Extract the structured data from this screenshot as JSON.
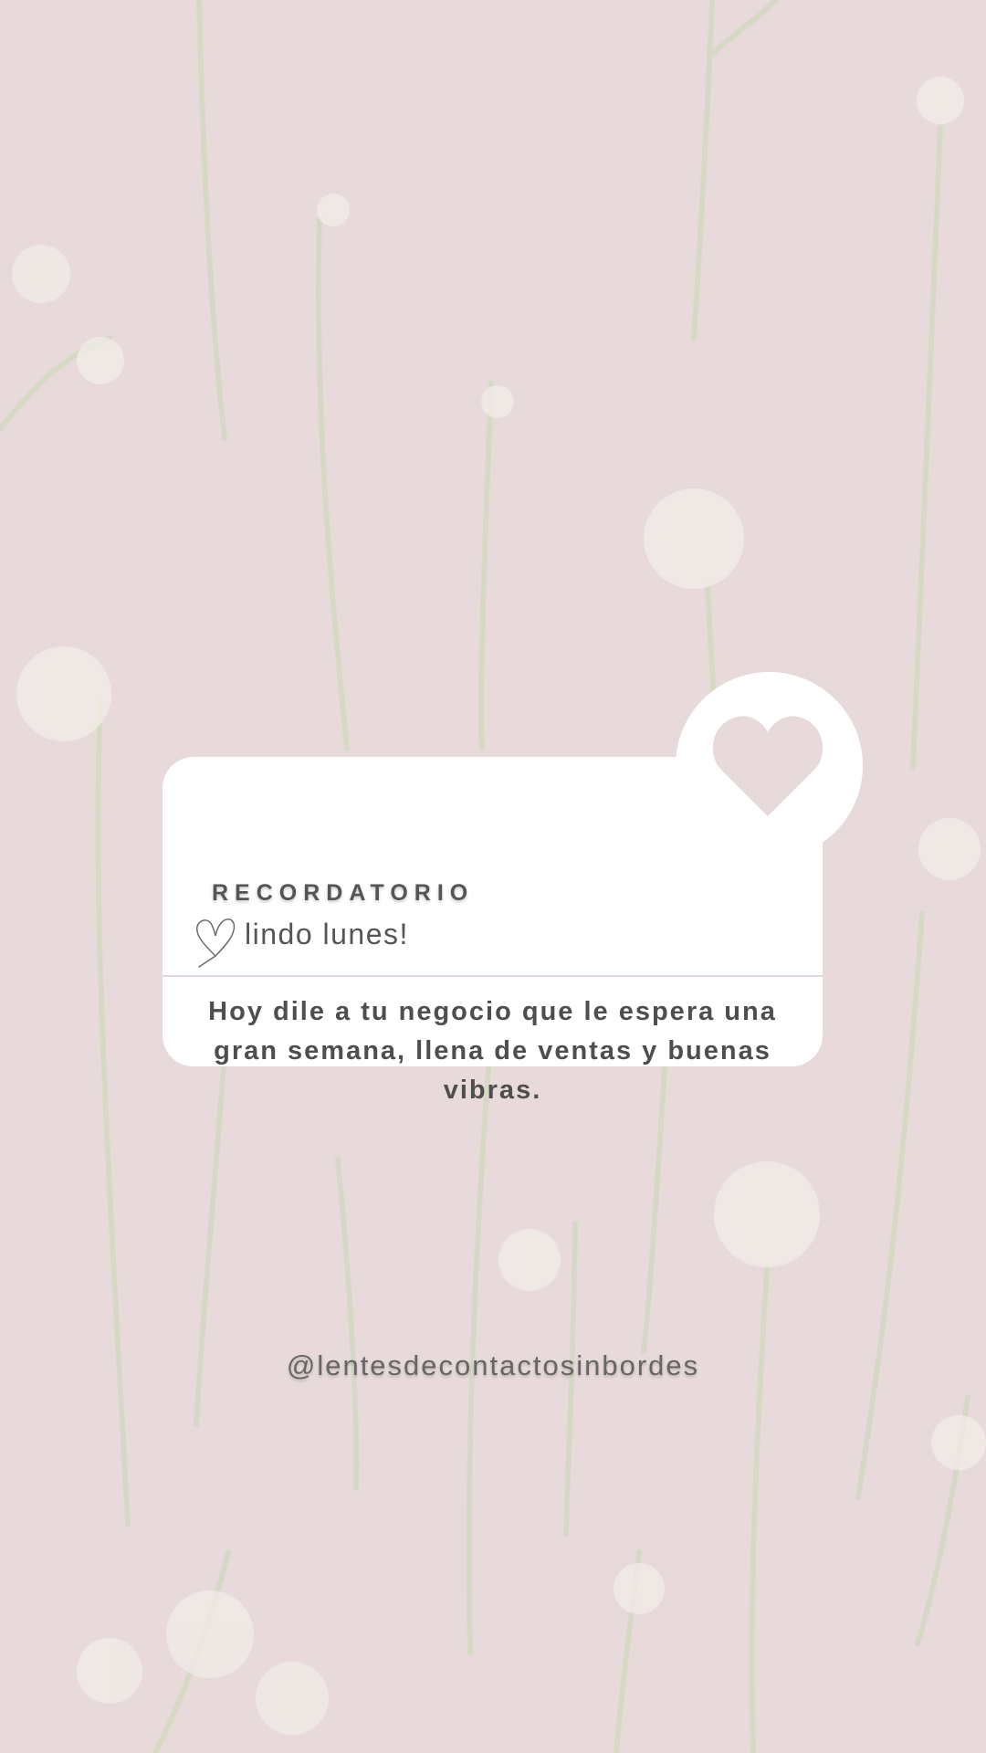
{
  "colors": {
    "background": "#e8dadb",
    "card": "#ffffff",
    "heart": "#e8dadb",
    "text": "#555555",
    "stem": "#d3d8c2",
    "flower": "#f0ebe6"
  },
  "icons": {
    "heart": "heart-icon",
    "doodle": "heart-doodle-icon"
  },
  "card": {
    "title": "RECORDATORIO",
    "subtitle": "lindo lunes!",
    "message": "Hoy dile a tu negocio que le espera una gran semana, llena de ventas y buenas vibras."
  },
  "footer": {
    "handle": "@lentesdecontactosinbordes"
  }
}
